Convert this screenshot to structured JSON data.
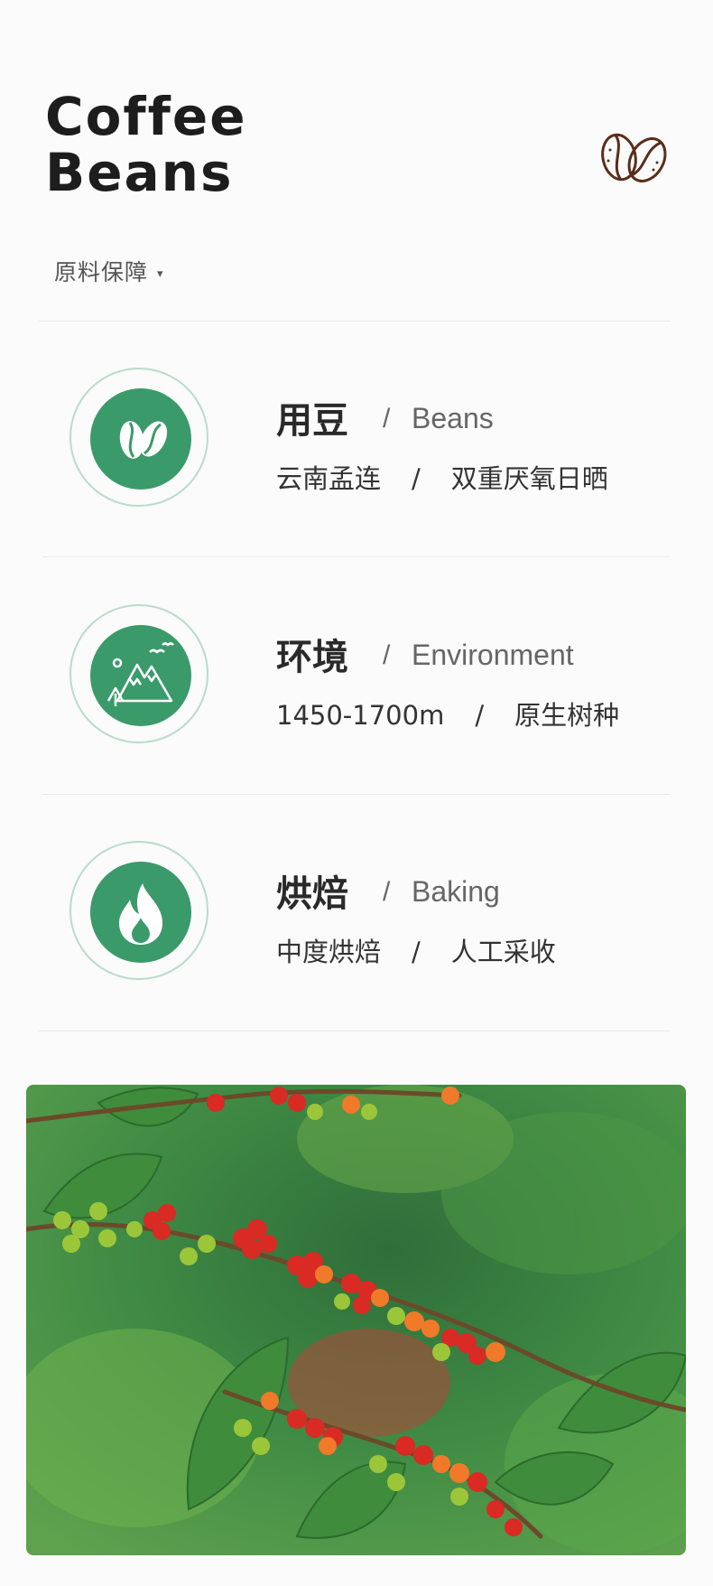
{
  "header": {
    "title_line1": "Coffee",
    "title_line2": "Beans",
    "logo_icon": "coffee-beans-icon"
  },
  "section": {
    "label": "原料保障",
    "caret": "▾"
  },
  "items": [
    {
      "title": "用豆",
      "slash": "/",
      "en": "Beans",
      "sub_left": "云南孟连",
      "sub_sep": "/",
      "sub_right": "双重厌氧日晒",
      "icon": "coffee-bean-icon"
    },
    {
      "title": "环境",
      "slash": "/",
      "en": "Environment",
      "sub_left": "1450-1700m",
      "sub_sep": "/",
      "sub_right": "原生树种",
      "icon": "mountain-icon"
    },
    {
      "title": "烘焙",
      "slash": "/",
      "en": "Baking",
      "sub_left": "中度烘焙",
      "sub_sep": "/",
      "sub_right": "人工采收",
      "icon": "flame-icon"
    }
  ],
  "colors": {
    "accent": "#3b9a6a",
    "ring": "#b9dccb",
    "bean_brown": "#5a2d1a"
  }
}
